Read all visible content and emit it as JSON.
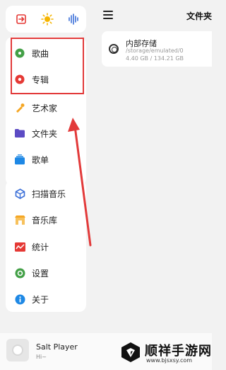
{
  "drawer": {
    "top_icons": [
      "exit-icon",
      "sun-icon",
      "equalizer-icon"
    ],
    "library_items": [
      {
        "label": "歌曲",
        "icon": "song-icon"
      },
      {
        "label": "专辑",
        "icon": "album-icon"
      },
      {
        "label": "艺术家",
        "icon": "artist-icon"
      },
      {
        "label": "文件夹",
        "icon": "folder-icon"
      },
      {
        "label": "歌单",
        "icon": "playlist-icon"
      }
    ],
    "tool_items": [
      {
        "label": "扫描音乐",
        "icon": "scan-icon"
      },
      {
        "label": "音乐库",
        "icon": "library-icon"
      },
      {
        "label": "统计",
        "icon": "stats-icon"
      },
      {
        "label": "设置",
        "icon": "settings-icon"
      },
      {
        "label": "关于",
        "icon": "about-icon"
      }
    ]
  },
  "header": {
    "title": "文件夹"
  },
  "storage": {
    "name": "内部存储",
    "path": "/storage/emulated/0",
    "size": "4.40 GB / 134.21 GB"
  },
  "player": {
    "title": "Salt Player",
    "subtitle": "Hi~"
  },
  "watermark": {
    "title": "顺祥手游网",
    "url": "www.bjsxsy.com"
  },
  "colors": {
    "highlight": "#e23a3a",
    "song": "#43a047",
    "album": "#e53935",
    "artist": "#f5a623",
    "folder": "#5c4bc4",
    "playlist": "#1e88e5",
    "scan": "#3b6fd8",
    "library": "#f5a623",
    "stats": "#e53935",
    "settings": "#43a047",
    "about": "#1e88e5"
  }
}
